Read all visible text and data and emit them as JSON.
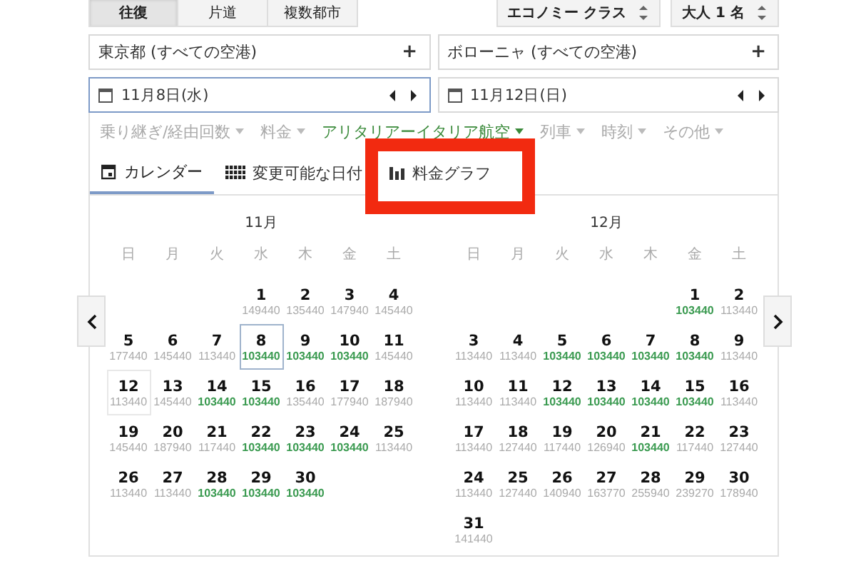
{
  "trip_types": [
    {
      "label": "往復",
      "selected": true
    },
    {
      "label": "片道",
      "selected": false
    },
    {
      "label": "複数都市",
      "selected": false
    }
  ],
  "cabin": {
    "value": "エコノミー クラス"
  },
  "passengers": {
    "value": "大人 1 名"
  },
  "origin": {
    "value": "東京都 (すべての空港)",
    "add": "+"
  },
  "destination": {
    "value": "ボローニャ (すべての空港)",
    "add": "+"
  },
  "dates": [
    {
      "value": "11月8日(水)",
      "focused": true
    },
    {
      "value": "11月12日(日)",
      "focused": false
    }
  ],
  "filters": [
    {
      "label": "乗り継ぎ/経由回数",
      "active": false
    },
    {
      "label": "料金",
      "active": false
    },
    {
      "label": "アリタリアーイタリア航空",
      "active": true
    },
    {
      "label": "列車",
      "active": false
    },
    {
      "label": "時刻",
      "active": false
    },
    {
      "label": "その他",
      "active": false
    }
  ],
  "view_tabs": [
    {
      "label": "カレンダー",
      "kind": "calendar",
      "selected": true,
      "highlighted": false
    },
    {
      "label": "変更可能な日付",
      "kind": "grid",
      "selected": false,
      "highlighted": false
    },
    {
      "label": "料金グラフ",
      "kind": "chart",
      "selected": false,
      "highlighted": true
    }
  ],
  "months": [
    {
      "title": "11月",
      "weekdays": [
        "日",
        "月",
        "火",
        "水",
        "木",
        "金",
        "土"
      ],
      "weeks": [
        [
          {
            "kind": "blank"
          },
          {
            "kind": "blank"
          },
          {
            "kind": "blank"
          },
          {
            "kind": "day",
            "day": "1",
            "price": "149440",
            "cheap": false,
            "departure": false,
            "return": false
          },
          {
            "kind": "day",
            "day": "2",
            "price": "135440",
            "cheap": false,
            "departure": false,
            "return": false
          },
          {
            "kind": "day",
            "day": "3",
            "price": "147940",
            "cheap": false,
            "departure": false,
            "return": false
          },
          {
            "kind": "day",
            "day": "4",
            "price": "145440",
            "cheap": false,
            "departure": false,
            "return": false
          }
        ],
        [
          {
            "kind": "day",
            "day": "5",
            "price": "177440",
            "cheap": false,
            "departure": false,
            "return": false
          },
          {
            "kind": "day",
            "day": "6",
            "price": "145440",
            "cheap": false,
            "departure": false,
            "return": false
          },
          {
            "kind": "day",
            "day": "7",
            "price": "113440",
            "cheap": false,
            "departure": false,
            "return": false
          },
          {
            "kind": "day",
            "day": "8",
            "price": "103440",
            "cheap": true,
            "departure": true,
            "return": false
          },
          {
            "kind": "day",
            "day": "9",
            "price": "103440",
            "cheap": true,
            "departure": false,
            "return": false
          },
          {
            "kind": "day",
            "day": "10",
            "price": "103440",
            "cheap": true,
            "departure": false,
            "return": false
          },
          {
            "kind": "day",
            "day": "11",
            "price": "145440",
            "cheap": false,
            "departure": false,
            "return": false
          }
        ],
        [
          {
            "kind": "day",
            "day": "12",
            "price": "113440",
            "cheap": false,
            "departure": false,
            "return": true
          },
          {
            "kind": "day",
            "day": "13",
            "price": "145440",
            "cheap": false,
            "departure": false,
            "return": false
          },
          {
            "kind": "day",
            "day": "14",
            "price": "103440",
            "cheap": true,
            "departure": false,
            "return": false
          },
          {
            "kind": "day",
            "day": "15",
            "price": "103440",
            "cheap": true,
            "departure": false,
            "return": false
          },
          {
            "kind": "day",
            "day": "16",
            "price": "135440",
            "cheap": false,
            "departure": false,
            "return": false
          },
          {
            "kind": "day",
            "day": "17",
            "price": "177940",
            "cheap": false,
            "departure": false,
            "return": false
          },
          {
            "kind": "day",
            "day": "18",
            "price": "187940",
            "cheap": false,
            "departure": false,
            "return": false
          }
        ],
        [
          {
            "kind": "day",
            "day": "19",
            "price": "145440",
            "cheap": false,
            "departure": false,
            "return": false
          },
          {
            "kind": "day",
            "day": "20",
            "price": "187940",
            "cheap": false,
            "departure": false,
            "return": false
          },
          {
            "kind": "day",
            "day": "21",
            "price": "117440",
            "cheap": false,
            "departure": false,
            "return": false
          },
          {
            "kind": "day",
            "day": "22",
            "price": "103440",
            "cheap": true,
            "departure": false,
            "return": false
          },
          {
            "kind": "day",
            "day": "23",
            "price": "103440",
            "cheap": true,
            "departure": false,
            "return": false
          },
          {
            "kind": "day",
            "day": "24",
            "price": "103440",
            "cheap": true,
            "departure": false,
            "return": false
          },
          {
            "kind": "day",
            "day": "25",
            "price": "113440",
            "cheap": false,
            "departure": false,
            "return": false
          }
        ],
        [
          {
            "kind": "day",
            "day": "26",
            "price": "113440",
            "cheap": false,
            "departure": false,
            "return": false
          },
          {
            "kind": "day",
            "day": "27",
            "price": "113440",
            "cheap": false,
            "departure": false,
            "return": false
          },
          {
            "kind": "day",
            "day": "28",
            "price": "103440",
            "cheap": true,
            "departure": false,
            "return": false
          },
          {
            "kind": "day",
            "day": "29",
            "price": "103440",
            "cheap": true,
            "departure": false,
            "return": false
          },
          {
            "kind": "day",
            "day": "30",
            "price": "103440",
            "cheap": true,
            "departure": false,
            "return": false
          }
        ]
      ]
    },
    {
      "title": "12月",
      "weekdays": [
        "日",
        "月",
        "火",
        "水",
        "木",
        "金",
        "土"
      ],
      "weeks": [
        [
          {
            "kind": "blank"
          },
          {
            "kind": "blank"
          },
          {
            "kind": "blank"
          },
          {
            "kind": "blank"
          },
          {
            "kind": "blank"
          },
          {
            "kind": "day",
            "day": "1",
            "price": "103440",
            "cheap": true,
            "departure": false,
            "return": false
          },
          {
            "kind": "day",
            "day": "2",
            "price": "113440",
            "cheap": false,
            "departure": false,
            "return": false
          }
        ],
        [
          {
            "kind": "day",
            "day": "3",
            "price": "113440",
            "cheap": false,
            "departure": false,
            "return": false
          },
          {
            "kind": "day",
            "day": "4",
            "price": "113440",
            "cheap": false,
            "departure": false,
            "return": false
          },
          {
            "kind": "day",
            "day": "5",
            "price": "103440",
            "cheap": true,
            "departure": false,
            "return": false
          },
          {
            "kind": "day",
            "day": "6",
            "price": "103440",
            "cheap": true,
            "departure": false,
            "return": false
          },
          {
            "kind": "day",
            "day": "7",
            "price": "103440",
            "cheap": true,
            "departure": false,
            "return": false
          },
          {
            "kind": "day",
            "day": "8",
            "price": "103440",
            "cheap": true,
            "departure": false,
            "return": false
          },
          {
            "kind": "day",
            "day": "9",
            "price": "113440",
            "cheap": false,
            "departure": false,
            "return": false
          }
        ],
        [
          {
            "kind": "day",
            "day": "10",
            "price": "113440",
            "cheap": false,
            "departure": false,
            "return": false
          },
          {
            "kind": "day",
            "day": "11",
            "price": "113440",
            "cheap": false,
            "departure": false,
            "return": false
          },
          {
            "kind": "day",
            "day": "12",
            "price": "103440",
            "cheap": true,
            "departure": false,
            "return": false
          },
          {
            "kind": "day",
            "day": "13",
            "price": "103440",
            "cheap": true,
            "departure": false,
            "return": false
          },
          {
            "kind": "day",
            "day": "14",
            "price": "103440",
            "cheap": true,
            "departure": false,
            "return": false
          },
          {
            "kind": "day",
            "day": "15",
            "price": "103440",
            "cheap": true,
            "departure": false,
            "return": false
          },
          {
            "kind": "day",
            "day": "16",
            "price": "113440",
            "cheap": false,
            "departure": false,
            "return": false
          }
        ],
        [
          {
            "kind": "day",
            "day": "17",
            "price": "113440",
            "cheap": false,
            "departure": false,
            "return": false
          },
          {
            "kind": "day",
            "day": "18",
            "price": "127440",
            "cheap": false,
            "departure": false,
            "return": false
          },
          {
            "kind": "day",
            "day": "19",
            "price": "117440",
            "cheap": false,
            "departure": false,
            "return": false
          },
          {
            "kind": "day",
            "day": "20",
            "price": "126940",
            "cheap": false,
            "departure": false,
            "return": false
          },
          {
            "kind": "day",
            "day": "21",
            "price": "103440",
            "cheap": true,
            "departure": false,
            "return": false
          },
          {
            "kind": "day",
            "day": "22",
            "price": "117440",
            "cheap": false,
            "departure": false,
            "return": false
          },
          {
            "kind": "day",
            "day": "23",
            "price": "127440",
            "cheap": false,
            "departure": false,
            "return": false
          }
        ],
        [
          {
            "kind": "day",
            "day": "24",
            "price": "113440",
            "cheap": false,
            "departure": false,
            "return": false
          },
          {
            "kind": "day",
            "day": "25",
            "price": "127440",
            "cheap": false,
            "departure": false,
            "return": false
          },
          {
            "kind": "day",
            "day": "26",
            "price": "140940",
            "cheap": false,
            "departure": false,
            "return": false
          },
          {
            "kind": "day",
            "day": "27",
            "price": "163770",
            "cheap": false,
            "departure": false,
            "return": false
          },
          {
            "kind": "day",
            "day": "28",
            "price": "255940",
            "cheap": false,
            "departure": false,
            "return": false
          },
          {
            "kind": "day",
            "day": "29",
            "price": "239270",
            "cheap": false,
            "departure": false,
            "return": false
          },
          {
            "kind": "day",
            "day": "30",
            "price": "178940",
            "cheap": false,
            "departure": false,
            "return": false
          }
        ],
        [
          {
            "kind": "day",
            "day": "31",
            "price": "141440",
            "cheap": false,
            "departure": false,
            "return": false
          }
        ]
      ]
    }
  ]
}
